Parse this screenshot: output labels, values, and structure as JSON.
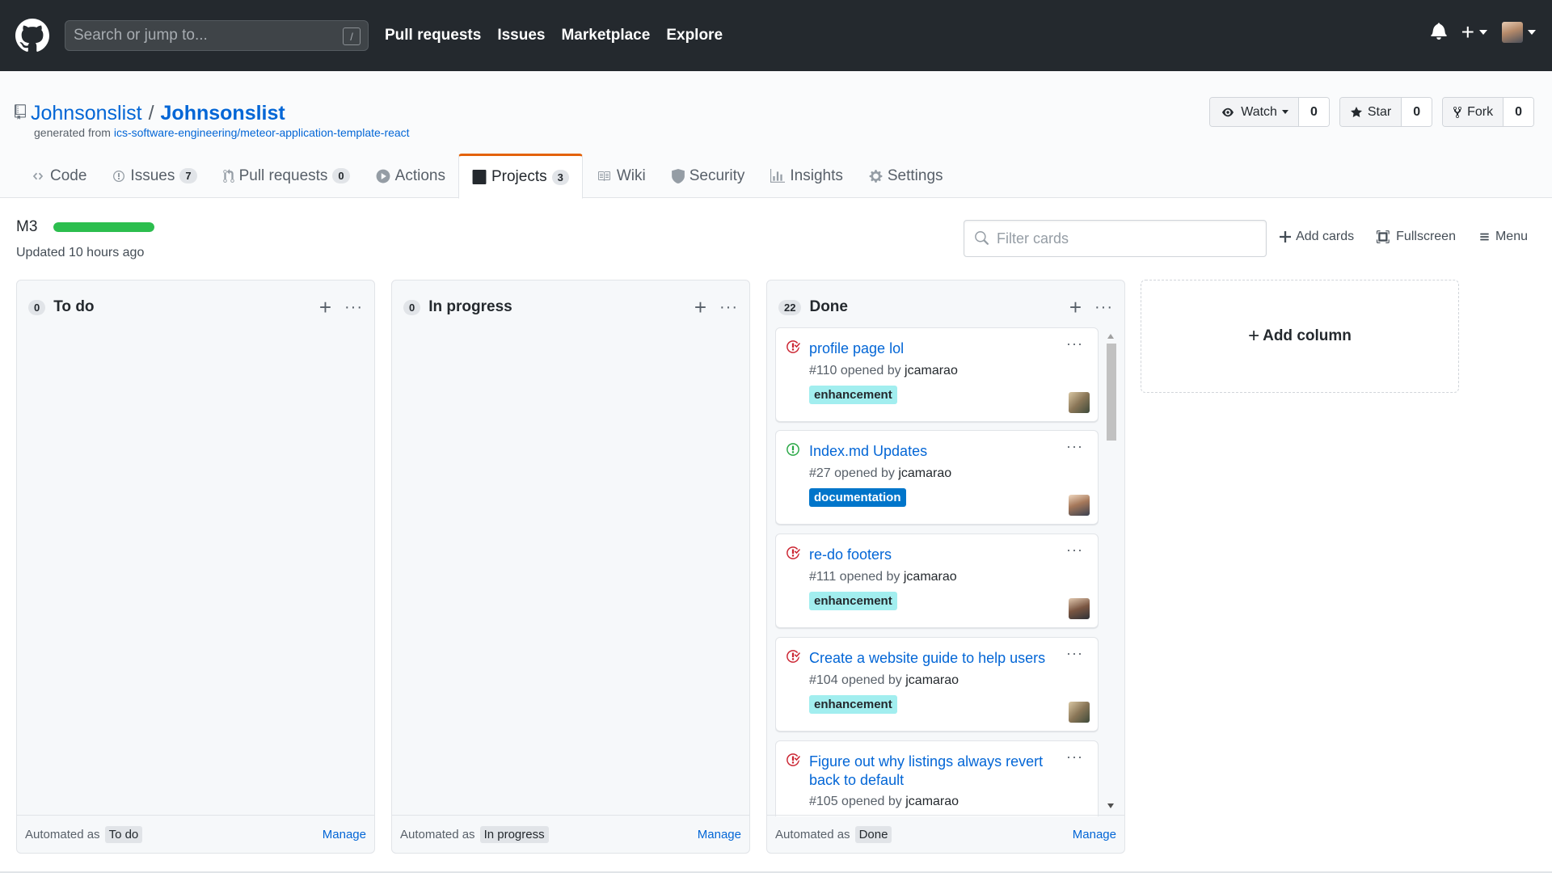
{
  "header": {
    "search_placeholder": "Search or jump to...",
    "search_key": "/",
    "nav": [
      "Pull requests",
      "Issues",
      "Marketplace",
      "Explore"
    ]
  },
  "repo": {
    "owner": "Johnsonslist",
    "separator": "/",
    "name": "Johnsonslist",
    "generated_prefix": "generated from",
    "generated_link": "ics-software-engineering/meteor-application-template-react",
    "watch_label": "Watch",
    "watch_count": "0",
    "star_label": "Star",
    "star_count": "0",
    "fork_label": "Fork",
    "fork_count": "0"
  },
  "tabs": [
    {
      "label": "Code",
      "count": ""
    },
    {
      "label": "Issues",
      "count": "7"
    },
    {
      "label": "Pull requests",
      "count": "0"
    },
    {
      "label": "Actions",
      "count": ""
    },
    {
      "label": "Projects",
      "count": "3"
    },
    {
      "label": "Wiki",
      "count": ""
    },
    {
      "label": "Security",
      "count": ""
    },
    {
      "label": "Insights",
      "count": ""
    },
    {
      "label": "Settings",
      "count": ""
    }
  ],
  "project": {
    "name": "M3",
    "progress_percent": 100,
    "updated": "Updated 10 hours ago",
    "filter_placeholder": "Filter cards",
    "add_cards": "Add cards",
    "fullscreen": "Fullscreen",
    "menu": "Menu",
    "add_column": "Add column"
  },
  "columns": [
    {
      "count": "0",
      "name": "To do",
      "automated_prefix": "Automated as",
      "automated_value": "To do",
      "manage": "Manage"
    },
    {
      "count": "0",
      "name": "In progress",
      "automated_prefix": "Automated as",
      "automated_value": "In progress",
      "manage": "Manage"
    },
    {
      "count": "22",
      "name": "Done",
      "automated_prefix": "Automated as",
      "automated_value": "Done",
      "manage": "Manage"
    }
  ],
  "done_cards": [
    {
      "title": "profile page lol",
      "number": "#110",
      "opened_by": "opened by",
      "user": "jcamarao",
      "label": "enhancement",
      "state": "closed"
    },
    {
      "title": "Index.md Updates",
      "number": "#27",
      "opened_by": "opened by",
      "user": "jcamarao",
      "label": "documentation",
      "state": "open"
    },
    {
      "title": "re-do footers",
      "number": "#111",
      "opened_by": "opened by",
      "user": "jcamarao",
      "label": "enhancement",
      "state": "closed"
    },
    {
      "title": "Create a website guide to help users",
      "number": "#104",
      "opened_by": "opened by",
      "user": "jcamarao",
      "label": "enhancement",
      "state": "closed"
    },
    {
      "title": "Figure out why listings always revert back to default",
      "number": "#105",
      "opened_by": "opened by",
      "user": "jcamarao",
      "label": "",
      "state": "closed"
    }
  ],
  "colors": {
    "header_bg": "#24292e",
    "link": "#0366d6",
    "selected_tab_border": "#e36209",
    "progress_fill": "#2cbe4e",
    "closed_icon": "#cb2431",
    "open_icon": "#28a745",
    "enhancement_label": "#a2eeef",
    "documentation_label": "#0075ca"
  },
  "icons": {
    "logo": "github-mark-icon",
    "bell": "bell-icon",
    "plus": "plus-icon",
    "eye": "eye-icon",
    "star": "star-icon",
    "fork": "fork-icon",
    "repo": "repo-icon",
    "search": "search-icon",
    "closed_issue": "issue-closed-icon",
    "open_issue": "issue-opened-icon"
  }
}
